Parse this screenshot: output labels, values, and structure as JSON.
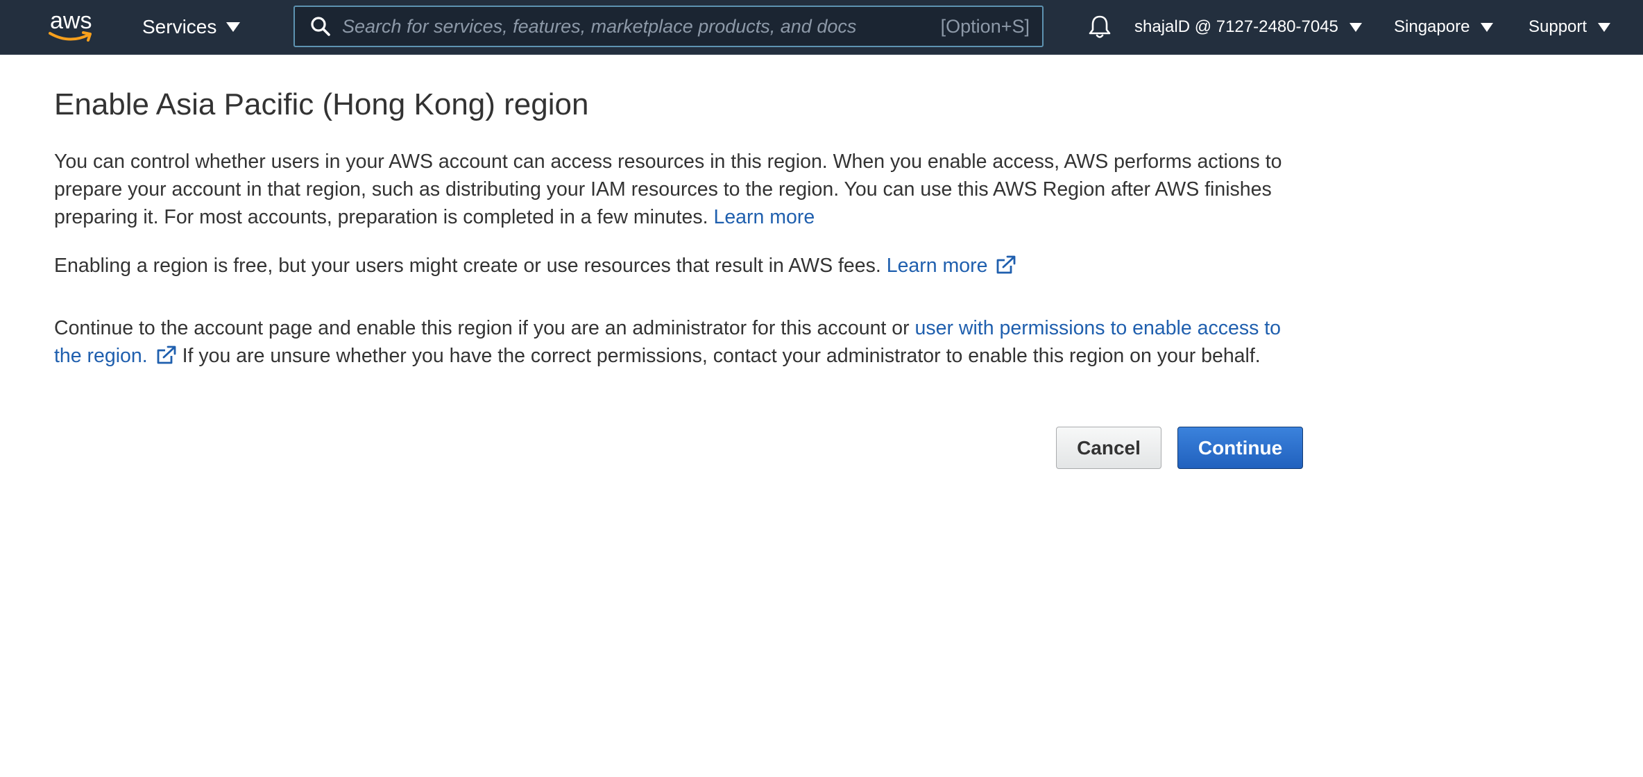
{
  "nav": {
    "logo_text": "aws",
    "services_label": "Services",
    "search": {
      "placeholder": "Search for services, features, marketplace products, and docs",
      "value": "",
      "shortcut": "[Option+S]"
    },
    "account_label": "shajalD @ 7127-2480-7045",
    "region_label": "Singapore",
    "support_label": "Support"
  },
  "page": {
    "title": "Enable Asia Pacific (Hong Kong) region",
    "para1_text": "You can control whether users in your AWS account can access resources in this region. When you enable access, AWS performs actions to prepare your account in that region, such as distributing your IAM resources to the region. You can use this AWS Region after AWS finishes preparing it. For most accounts, preparation is completed in a few minutes.",
    "para1_link": "Learn more",
    "para2_text": "Enabling a region is free, but your users might create or use resources that result in AWS fees.",
    "para2_link": "Learn more",
    "para3_text_before": "Continue to the account page and enable this region if you are an administrator for this account or",
    "para3_link": "user with permissions to enable access to the region.",
    "para3_text_after": "If you are unsure whether you have the correct permissions, contact your administrator to enable this region on your behalf."
  },
  "actions": {
    "cancel_label": "Cancel",
    "continue_label": "Continue"
  },
  "colors": {
    "nav_background": "#232f3e",
    "link": "#1f5fae",
    "primary_button": "#2a6fcb",
    "logo_smile": "#f7a01d"
  },
  "icons": {
    "search": "search-icon",
    "bell": "bell-icon",
    "external_link": "external-link-icon",
    "caret": "caret-down-icon"
  }
}
